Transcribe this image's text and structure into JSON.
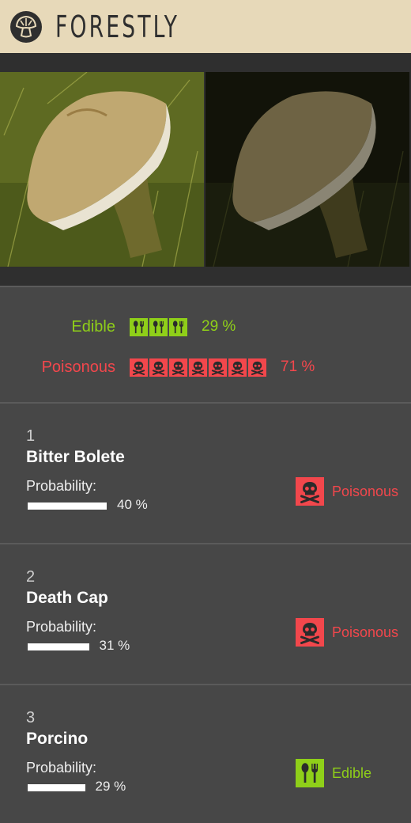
{
  "app": {
    "title": "FORESTLY",
    "logo_icon": "mushroom-icon"
  },
  "colors": {
    "edible": "#8fcf19",
    "poisonous": "#f2474c",
    "header_bg": "#e7d9b9",
    "panel_bg": "#474747"
  },
  "summary": {
    "edible": {
      "label": "Edible",
      "percent_text": "29 %",
      "percent": 29,
      "icon": "cutlery-icon",
      "icon_count": 3
    },
    "poisonous": {
      "label": "Poisonous",
      "percent_text": "71 %",
      "percent": 71,
      "icon": "skull-crossbones-icon",
      "icon_count": 7
    }
  },
  "results": [
    {
      "rank": "1",
      "name": "Bitter Bolete",
      "probability_label": "Probability:",
      "probability": 40,
      "probability_text": "40 %",
      "verdict": "Poisonous",
      "verdict_icon": "skull-crossbones-icon"
    },
    {
      "rank": "2",
      "name": "Death Cap",
      "probability_label": "Probability:",
      "probability": 31,
      "probability_text": "31 %",
      "verdict": "Poisonous",
      "verdict_icon": "skull-crossbones-icon"
    },
    {
      "rank": "3",
      "name": "Porcino",
      "probability_label": "Probability:",
      "probability": 29,
      "probability_text": "29 %",
      "verdict": "Edible",
      "verdict_icon": "cutlery-icon"
    }
  ]
}
